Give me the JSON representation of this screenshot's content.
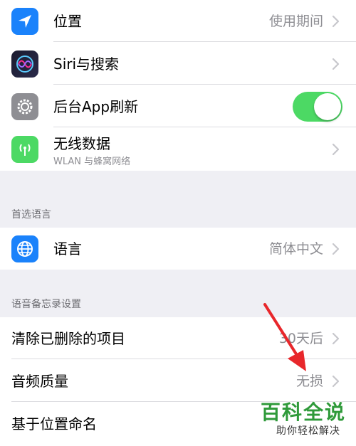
{
  "colors": {
    "accent_blue": "#1a82fb",
    "toggle_on": "#4cd964",
    "settings_gray": "#8e8e93",
    "cellular_green": "#4cd964",
    "watermark_green": "#2f9a3a",
    "arrow_red": "#e8272b"
  },
  "rows": [
    {
      "label": "位置",
      "value": "使用期间",
      "icon": "location-arrow-icon"
    },
    {
      "label": "Siri与搜索",
      "icon": "siri-icon"
    },
    {
      "label": "后台App刷新",
      "icon": "gear-icon",
      "toggle_on": true
    },
    {
      "label": "无线数据",
      "sublabel": "WLAN 与蜂窝网络",
      "icon": "antenna-icon"
    }
  ],
  "section_preferred_language": {
    "header": "首选语言",
    "rows": [
      {
        "label": "语言",
        "value": "简体中文",
        "icon": "globe-icon"
      }
    ]
  },
  "section_voice_memos": {
    "header": "语音备忘录设置",
    "rows": [
      {
        "label": "清除已删除的项目",
        "value": "30天后"
      },
      {
        "label": "音频质量",
        "value": "无损"
      },
      {
        "label": "基于位置命名"
      }
    ]
  },
  "watermark": {
    "title": "百科全说",
    "subtitle": "助你轻松解决"
  }
}
